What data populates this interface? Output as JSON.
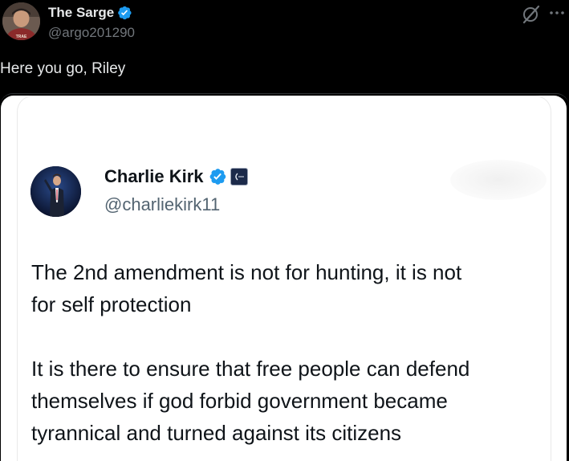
{
  "post": {
    "author_name": "The Sarge",
    "author_handle": "@argo201290",
    "text": "Here you go, Riley",
    "avatar_text": "TRAE",
    "icons": {
      "verified": "verified-badge-icon",
      "grok": "grok-icon",
      "more": "more-options-icon"
    }
  },
  "quoted": {
    "author_name": "Charlie Kirk",
    "author_handle": "@charliekirk11",
    "paragraph1": [
      "The 2nd amendment is not for hunting, it is not",
      "for self protection"
    ],
    "paragraph2": [
      "It is there to ensure that free people can defend",
      "themselves if god forbid government became",
      "tyrannical and turned against its citizens"
    ],
    "icons": {
      "verified": "verified-badge-icon",
      "affiliation": "affiliation-badge-icon"
    }
  },
  "colors": {
    "background": "#000000",
    "primary_text": "#e7e9ea",
    "secondary_text": "#71767b",
    "verified_blue": "#1d9bf0",
    "quoted_text": "#0f1419",
    "quoted_handle": "#536471"
  }
}
